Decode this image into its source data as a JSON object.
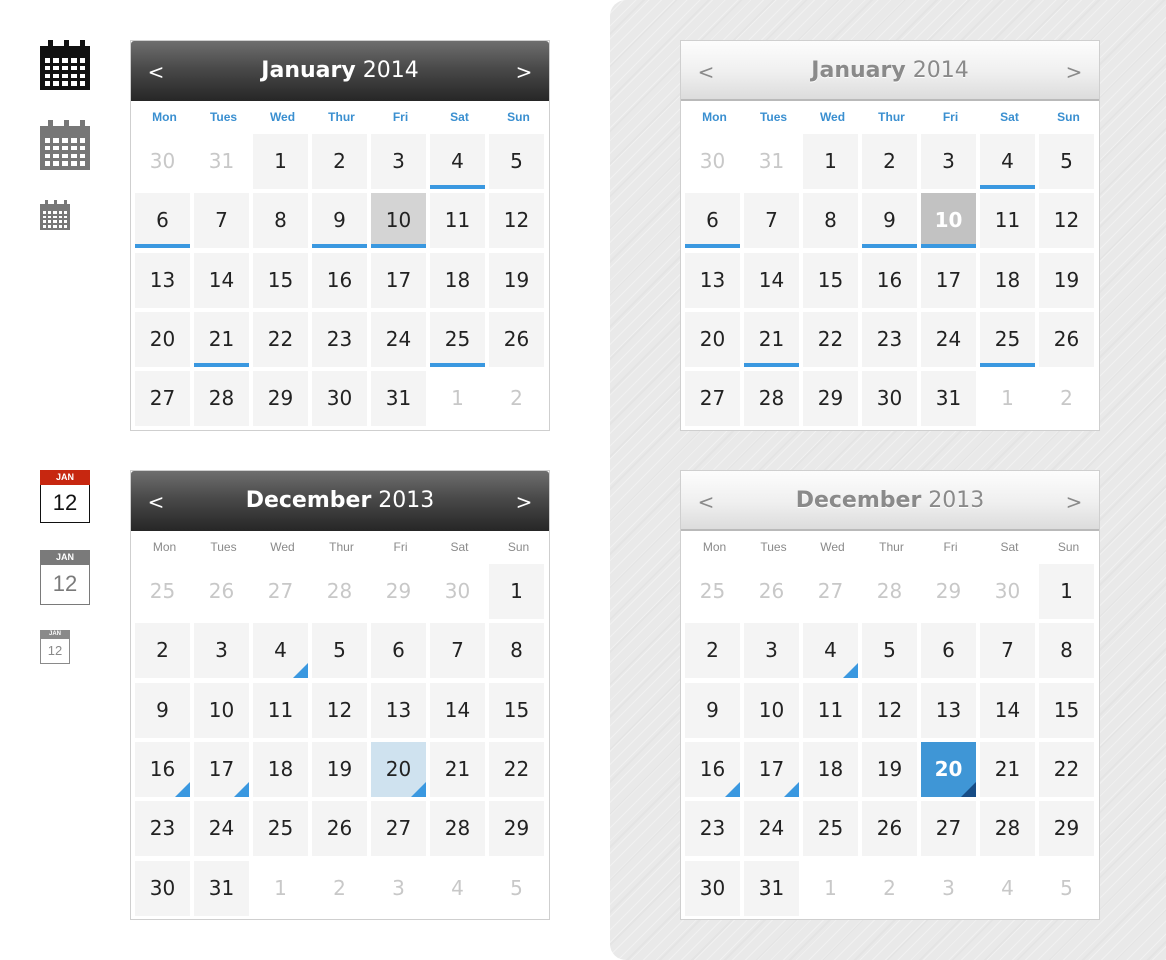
{
  "colors": {
    "accent": "#3a98e0",
    "icon_dark": "#111111",
    "icon_gray": "#777777",
    "icon_red": "#c72710"
  },
  "icons": [
    {
      "name": "calendar-grid-icon-large",
      "color": "#111111"
    },
    {
      "name": "calendar-grid-icon-medium",
      "color": "#777777"
    },
    {
      "name": "calendar-grid-icon-small",
      "color": "#777777"
    }
  ],
  "date_icons": [
    {
      "month": "JAN",
      "day": "12",
      "color": "#c72710"
    },
    {
      "month": "JAN",
      "day": "12",
      "color": "#7a7a7a"
    },
    {
      "month": "JAN",
      "day": "12",
      "color": "#8a8a8a"
    }
  ],
  "weekdays": [
    "Mon",
    "Tues",
    "Wed",
    "Thur",
    "Fri",
    "Sat",
    "Sun"
  ],
  "calendars": [
    {
      "id": "jan-dark",
      "theme": "dark",
      "month": "January",
      "year": "2014",
      "prev_label": "<",
      "next_label": ">",
      "dow_style": "blue",
      "days": [
        {
          "d": "30",
          "muted": true
        },
        {
          "d": "31",
          "muted": true
        },
        {
          "d": "1"
        },
        {
          "d": "2"
        },
        {
          "d": "3"
        },
        {
          "d": "4",
          "mark": true
        },
        {
          "d": "5"
        },
        {
          "d": "6",
          "mark": true
        },
        {
          "d": "7"
        },
        {
          "d": "8"
        },
        {
          "d": "9",
          "mark": true
        },
        {
          "d": "10",
          "mark": true,
          "sel": "sel-dark"
        },
        {
          "d": "11"
        },
        {
          "d": "12"
        },
        {
          "d": "13"
        },
        {
          "d": "14"
        },
        {
          "d": "15"
        },
        {
          "d": "16"
        },
        {
          "d": "17"
        },
        {
          "d": "18"
        },
        {
          "d": "19"
        },
        {
          "d": "20"
        },
        {
          "d": "21",
          "mark": true
        },
        {
          "d": "22"
        },
        {
          "d": "23"
        },
        {
          "d": "24"
        },
        {
          "d": "25",
          "mark": true
        },
        {
          "d": "26"
        },
        {
          "d": "27"
        },
        {
          "d": "28"
        },
        {
          "d": "29"
        },
        {
          "d": "30"
        },
        {
          "d": "31"
        },
        {
          "d": "1",
          "muted": true
        },
        {
          "d": "2",
          "muted": true
        }
      ]
    },
    {
      "id": "jan-light",
      "theme": "light",
      "month": "January",
      "year": "2014",
      "prev_label": "<",
      "next_label": ">",
      "dow_style": "blue",
      "days": [
        {
          "d": "30",
          "muted": true
        },
        {
          "d": "31",
          "muted": true
        },
        {
          "d": "1"
        },
        {
          "d": "2"
        },
        {
          "d": "3"
        },
        {
          "d": "4",
          "mark": true
        },
        {
          "d": "5"
        },
        {
          "d": "6",
          "mark": true
        },
        {
          "d": "7"
        },
        {
          "d": "8"
        },
        {
          "d": "9",
          "mark": true
        },
        {
          "d": "10",
          "mark": true,
          "sel": "sel-light"
        },
        {
          "d": "11"
        },
        {
          "d": "12"
        },
        {
          "d": "13"
        },
        {
          "d": "14"
        },
        {
          "d": "15"
        },
        {
          "d": "16"
        },
        {
          "d": "17"
        },
        {
          "d": "18"
        },
        {
          "d": "19"
        },
        {
          "d": "20"
        },
        {
          "d": "21",
          "mark": true
        },
        {
          "d": "22"
        },
        {
          "d": "23"
        },
        {
          "d": "24"
        },
        {
          "d": "25",
          "mark": true
        },
        {
          "d": "26"
        },
        {
          "d": "27"
        },
        {
          "d": "28"
        },
        {
          "d": "29"
        },
        {
          "d": "30"
        },
        {
          "d": "31"
        },
        {
          "d": "1",
          "muted": true
        },
        {
          "d": "2",
          "muted": true
        }
      ]
    },
    {
      "id": "dec-dark",
      "theme": "dark",
      "month": "December",
      "year": "2013",
      "prev_label": "<",
      "next_label": ">",
      "dow_style": "gray",
      "days": [
        {
          "d": "25",
          "muted": true
        },
        {
          "d": "26",
          "muted": true
        },
        {
          "d": "27",
          "muted": true
        },
        {
          "d": "28",
          "muted": true
        },
        {
          "d": "29",
          "muted": true
        },
        {
          "d": "30",
          "muted": true
        },
        {
          "d": "1"
        },
        {
          "d": "2"
        },
        {
          "d": "3"
        },
        {
          "d": "4",
          "event": true
        },
        {
          "d": "5"
        },
        {
          "d": "6"
        },
        {
          "d": "7"
        },
        {
          "d": "8"
        },
        {
          "d": "9"
        },
        {
          "d": "10"
        },
        {
          "d": "11"
        },
        {
          "d": "12"
        },
        {
          "d": "13"
        },
        {
          "d": "14"
        },
        {
          "d": "15"
        },
        {
          "d": "16",
          "event": true
        },
        {
          "d": "17",
          "event": true
        },
        {
          "d": "18"
        },
        {
          "d": "19"
        },
        {
          "d": "20",
          "event": true,
          "sel": "sel-pale"
        },
        {
          "d": "21"
        },
        {
          "d": "22"
        },
        {
          "d": "23"
        },
        {
          "d": "24"
        },
        {
          "d": "25"
        },
        {
          "d": "26"
        },
        {
          "d": "27"
        },
        {
          "d": "28"
        },
        {
          "d": "29"
        },
        {
          "d": "30"
        },
        {
          "d": "31"
        },
        {
          "d": "1",
          "muted": true
        },
        {
          "d": "2",
          "muted": true
        },
        {
          "d": "3",
          "muted": true
        },
        {
          "d": "4",
          "muted": true
        },
        {
          "d": "5",
          "muted": true
        }
      ]
    },
    {
      "id": "dec-light",
      "theme": "light",
      "month": "December",
      "year": "2013",
      "prev_label": "<",
      "next_label": ">",
      "dow_style": "gray",
      "days": [
        {
          "d": "25",
          "muted": true
        },
        {
          "d": "26",
          "muted": true
        },
        {
          "d": "27",
          "muted": true
        },
        {
          "d": "28",
          "muted": true
        },
        {
          "d": "29",
          "muted": true
        },
        {
          "d": "30",
          "muted": true
        },
        {
          "d": "1"
        },
        {
          "d": "2"
        },
        {
          "d": "3"
        },
        {
          "d": "4",
          "event": true
        },
        {
          "d": "5"
        },
        {
          "d": "6"
        },
        {
          "d": "7"
        },
        {
          "d": "8"
        },
        {
          "d": "9"
        },
        {
          "d": "10"
        },
        {
          "d": "11"
        },
        {
          "d": "12"
        },
        {
          "d": "13"
        },
        {
          "d": "14"
        },
        {
          "d": "15"
        },
        {
          "d": "16",
          "event": true
        },
        {
          "d": "17",
          "event": true
        },
        {
          "d": "18"
        },
        {
          "d": "19"
        },
        {
          "d": "20",
          "event": true,
          "sel": "sel-blue"
        },
        {
          "d": "21"
        },
        {
          "d": "22"
        },
        {
          "d": "23"
        },
        {
          "d": "24"
        },
        {
          "d": "25"
        },
        {
          "d": "26"
        },
        {
          "d": "27"
        },
        {
          "d": "28"
        },
        {
          "d": "29"
        },
        {
          "d": "30"
        },
        {
          "d": "31"
        },
        {
          "d": "1",
          "muted": true
        },
        {
          "d": "2",
          "muted": true
        },
        {
          "d": "3",
          "muted": true
        },
        {
          "d": "4",
          "muted": true
        },
        {
          "d": "5",
          "muted": true
        }
      ]
    }
  ]
}
